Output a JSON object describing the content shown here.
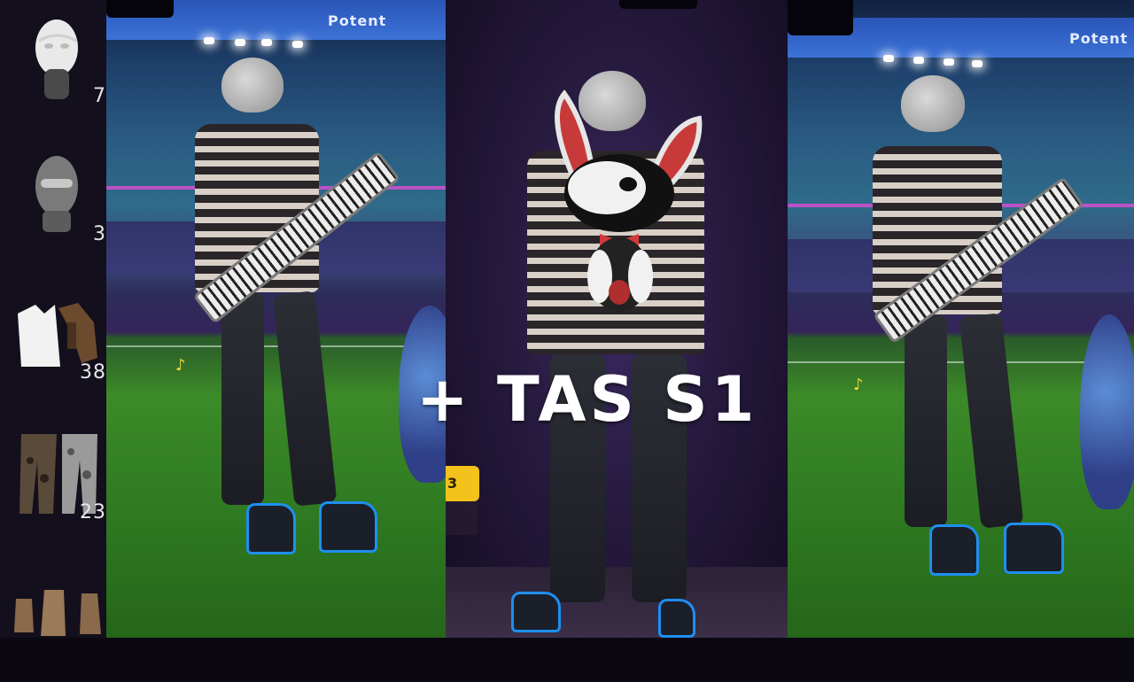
{
  "inventory": {
    "items": [
      {
        "name": "white-mask",
        "count": "7"
      },
      {
        "name": "balaclava",
        "count": "3"
      },
      {
        "name": "vest-top",
        "count": "38"
      },
      {
        "name": "camo-pants",
        "count": "23"
      },
      {
        "name": "boots",
        "count": ""
      }
    ]
  },
  "stadium": {
    "banner_text": "Potent"
  },
  "overlay": {
    "title": "+ TAS S1",
    "badge": "3"
  },
  "colors": {
    "accent_blue": "#1e8ff0",
    "badge_yellow": "#f3c21b",
    "overlay_text": "#ffffff"
  }
}
